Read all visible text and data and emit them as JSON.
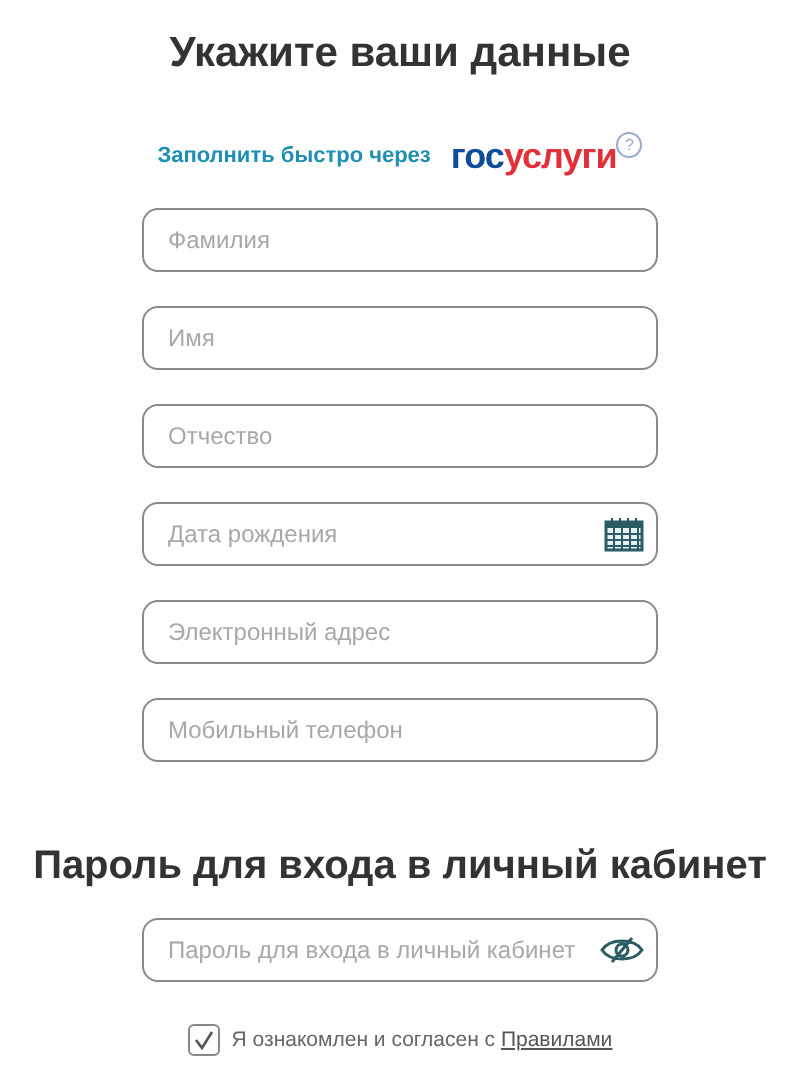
{
  "title": "Укажите ваши данные",
  "gosuslugi": {
    "label": "Заполнить быстро через",
    "logo": [
      "гос",
      "услуги"
    ],
    "help": "?"
  },
  "fields": [
    {
      "placeholder": "Фамилия",
      "kind": "text"
    },
    {
      "placeholder": "Имя",
      "kind": "text"
    },
    {
      "placeholder": "Отчество",
      "kind": "text"
    },
    {
      "placeholder": "Дата рождения",
      "kind": "date"
    },
    {
      "placeholder": "Электронный адрес",
      "kind": "text"
    },
    {
      "placeholder": "Мобильный телефон",
      "kind": "text"
    }
  ],
  "password_heading": "Пароль для входа в личный кабинет",
  "password_field": {
    "placeholder": "Пароль для входа в личный кабинет",
    "kind": "password"
  },
  "agreement": {
    "text": "Я ознакомлен и согласен с ",
    "link": "Правилами",
    "checked": true
  }
}
